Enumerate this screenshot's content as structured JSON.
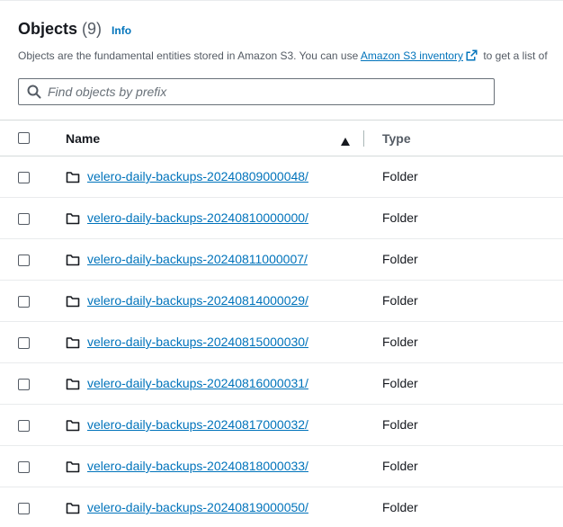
{
  "header": {
    "title": "Objects",
    "count": "(9)",
    "info_label": "Info"
  },
  "description": {
    "text_before": "Objects are the fundamental entities stored in Amazon S3. You can use ",
    "link_label": "Amazon S3 inventory",
    "text_after": " to get a list of"
  },
  "search": {
    "placeholder": "Find objects by prefix",
    "value": ""
  },
  "table": {
    "columns": {
      "name": "Name",
      "type": "Type"
    },
    "sort": {
      "column": "Name",
      "direction": "ascending"
    },
    "rows": [
      {
        "name": "velero-daily-backups-20240809000048/",
        "type": "Folder"
      },
      {
        "name": "velero-daily-backups-20240810000000/",
        "type": "Folder"
      },
      {
        "name": "velero-daily-backups-20240811000007/",
        "type": "Folder"
      },
      {
        "name": "velero-daily-backups-20240814000029/",
        "type": "Folder"
      },
      {
        "name": "velero-daily-backups-20240815000030/",
        "type": "Folder"
      },
      {
        "name": "velero-daily-backups-20240816000031/",
        "type": "Folder"
      },
      {
        "name": "velero-daily-backups-20240817000032/",
        "type": "Folder"
      },
      {
        "name": "velero-daily-backups-20240818000033/",
        "type": "Folder"
      },
      {
        "name": "velero-daily-backups-20240819000050/",
        "type": "Folder"
      }
    ]
  },
  "icons": {
    "search": "search-icon",
    "external_link": "external-link-icon",
    "sort": "sort-ascending-icon",
    "folder": "folder-icon"
  },
  "colors": {
    "link": "#0073bb",
    "text": "#16191f",
    "secondary_text": "#545b64",
    "border": "#d5dbdb"
  }
}
